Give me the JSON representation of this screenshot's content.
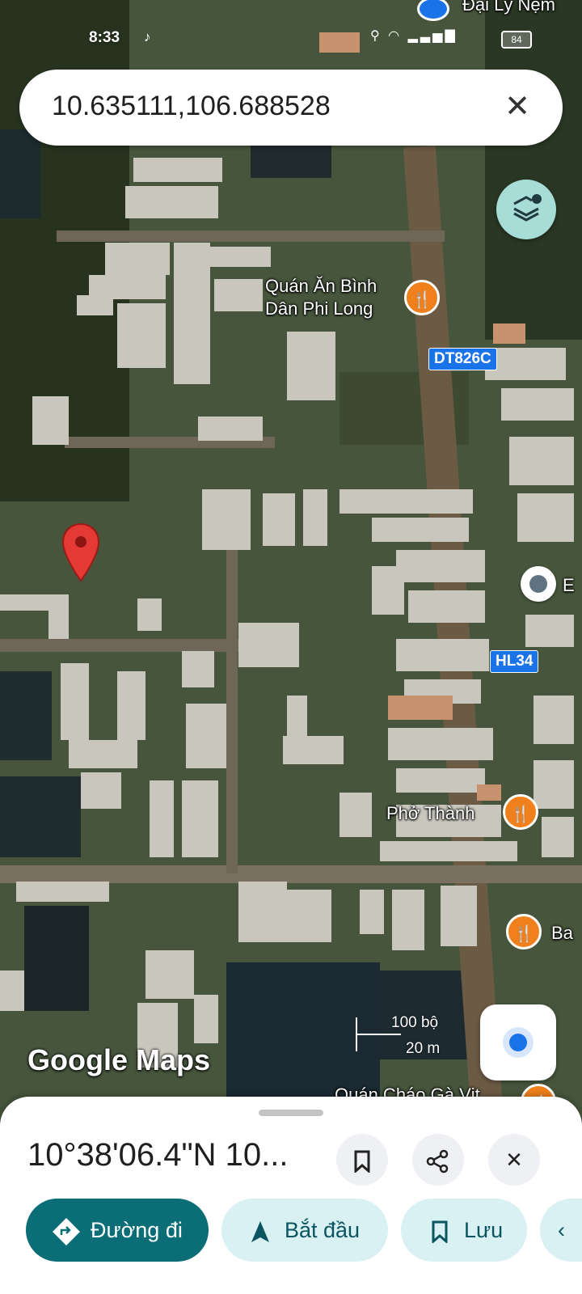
{
  "status_bar": {
    "time": "8:33",
    "battery": "84",
    "app_icon": "tiktok-icon"
  },
  "search": {
    "query": "10.635111,106.688528",
    "clear_icon": "close-icon"
  },
  "map": {
    "top_poi": "Đại Lý Nệm",
    "pois": [
      {
        "name_line1": "Quán Ăn Bình",
        "name_line2": "Dân Phi Long",
        "icon": "restaurant-icon"
      },
      {
        "name": "Phở Thành",
        "icon": "restaurant-icon"
      },
      {
        "name": "Ba",
        "icon": "restaurant-icon"
      },
      {
        "name": "Quán Cháo Gà Vịt",
        "icon": "restaurant-icon"
      },
      {
        "name": "E",
        "icon": "place-icon"
      }
    ],
    "roads": [
      "DT826C",
      "HL34"
    ],
    "scale": {
      "imperial": "100 bộ",
      "metric": "20 m"
    },
    "watermark": "Google Maps",
    "accent": "#1a73e8",
    "pin_color": "#e53935"
  },
  "sheet": {
    "coordinates": "10°38'06.4\"N 10...",
    "actions": {
      "directions": "Đường đi",
      "start": "Bắt đầu",
      "save": "Lưu"
    },
    "primary_color": "#0b6e77",
    "secondary_color": "#d9f1f3"
  }
}
